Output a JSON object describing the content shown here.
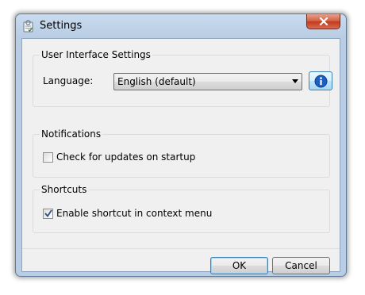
{
  "window": {
    "title": "Settings",
    "app_icon": "settings-app-icon",
    "close_icon": "close-icon"
  },
  "ui_settings": {
    "legend": "User Interface Settings",
    "language_label": "Language:",
    "language_value": "English (default)",
    "info_icon": "info-icon"
  },
  "notifications": {
    "legend": "Notifications",
    "check_updates_label": "Check for updates on startup",
    "check_updates_checked": false
  },
  "shortcuts": {
    "legend": "Shortcuts",
    "context_menu_label": "Enable shortcut in context menu",
    "context_menu_checked": true
  },
  "buttons": {
    "ok_label": "OK",
    "cancel_label": "Cancel"
  }
}
